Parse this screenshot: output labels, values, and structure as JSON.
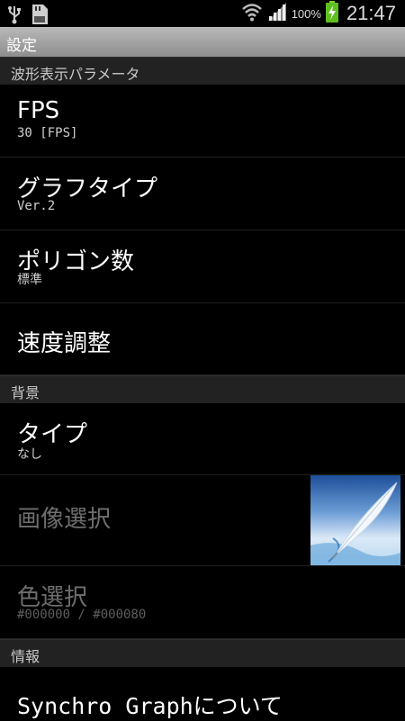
{
  "status_bar": {
    "battery_percent": "100%",
    "clock": "21:47",
    "icons": [
      "usb-icon",
      "sd-card-icon",
      "wifi-icon",
      "signal-icon",
      "battery-charging-icon"
    ]
  },
  "title_bar": {
    "title": "設定"
  },
  "sections": [
    {
      "header": "波形表示パラメータ"
    },
    {
      "header": "背景"
    },
    {
      "header": "情報"
    }
  ],
  "prefs": {
    "fps": {
      "title": "FPS",
      "summary": "30 [FPS]"
    },
    "graph_type": {
      "title": "グラフタイプ",
      "summary": "Ver.2"
    },
    "polygons": {
      "title": "ポリゴン数",
      "summary": "標準"
    },
    "speed": {
      "title": "速度調整"
    },
    "bg_type": {
      "title": "タイプ",
      "summary": "なし"
    },
    "image_select": {
      "title": "画像選択",
      "thumbnail": "feather-quill-image"
    },
    "color_select": {
      "title": "色選択",
      "summary": "#000000 / #000080"
    },
    "about": {
      "title": "Synchro Graphについて"
    }
  },
  "colors": {
    "background": "#000000",
    "category_bg": "#222222",
    "disabled_text": "#6e6e6e"
  }
}
